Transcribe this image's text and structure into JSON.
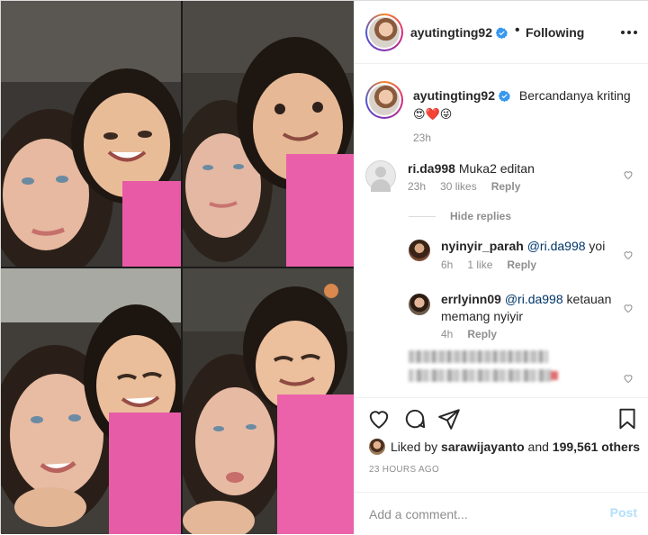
{
  "post": {
    "username": "ayutingting92",
    "follow_separator": "•",
    "follow_status": "Following",
    "caption_text": "Bercandanya kriting",
    "caption_emoji": "😍❤️😜",
    "caption_time": "23h"
  },
  "comments": [
    {
      "username": "ri.da998",
      "text": "Muka2 editan",
      "time": "23h",
      "likes": "30 likes",
      "reply_label": "Reply"
    }
  ],
  "hide_replies_label": "Hide replies",
  "replies": [
    {
      "username": "nyinyir_parah",
      "mention": "@ri.da998",
      "text": "yoi",
      "time": "6h",
      "likes": "1 like",
      "reply_label": "Reply"
    },
    {
      "username": "errlyinn09",
      "mention": "@ri.da998",
      "text": "ketauan memang nyiyir",
      "time": "4h",
      "reply_label": "Reply"
    }
  ],
  "likes": {
    "prefix": "Liked by",
    "user": "sarawijayanto",
    "conjunction": "and",
    "count": "199,561 others"
  },
  "timestamp": "23 HOURS AGO",
  "add_comment": {
    "placeholder": "Add a comment...",
    "post_label": "Post"
  },
  "colors": {
    "verified_blue": "#3897f0",
    "text": "#262626",
    "muted": "#8e8e8e",
    "mention": "#003569",
    "post_disabled": "#b2dffc"
  }
}
